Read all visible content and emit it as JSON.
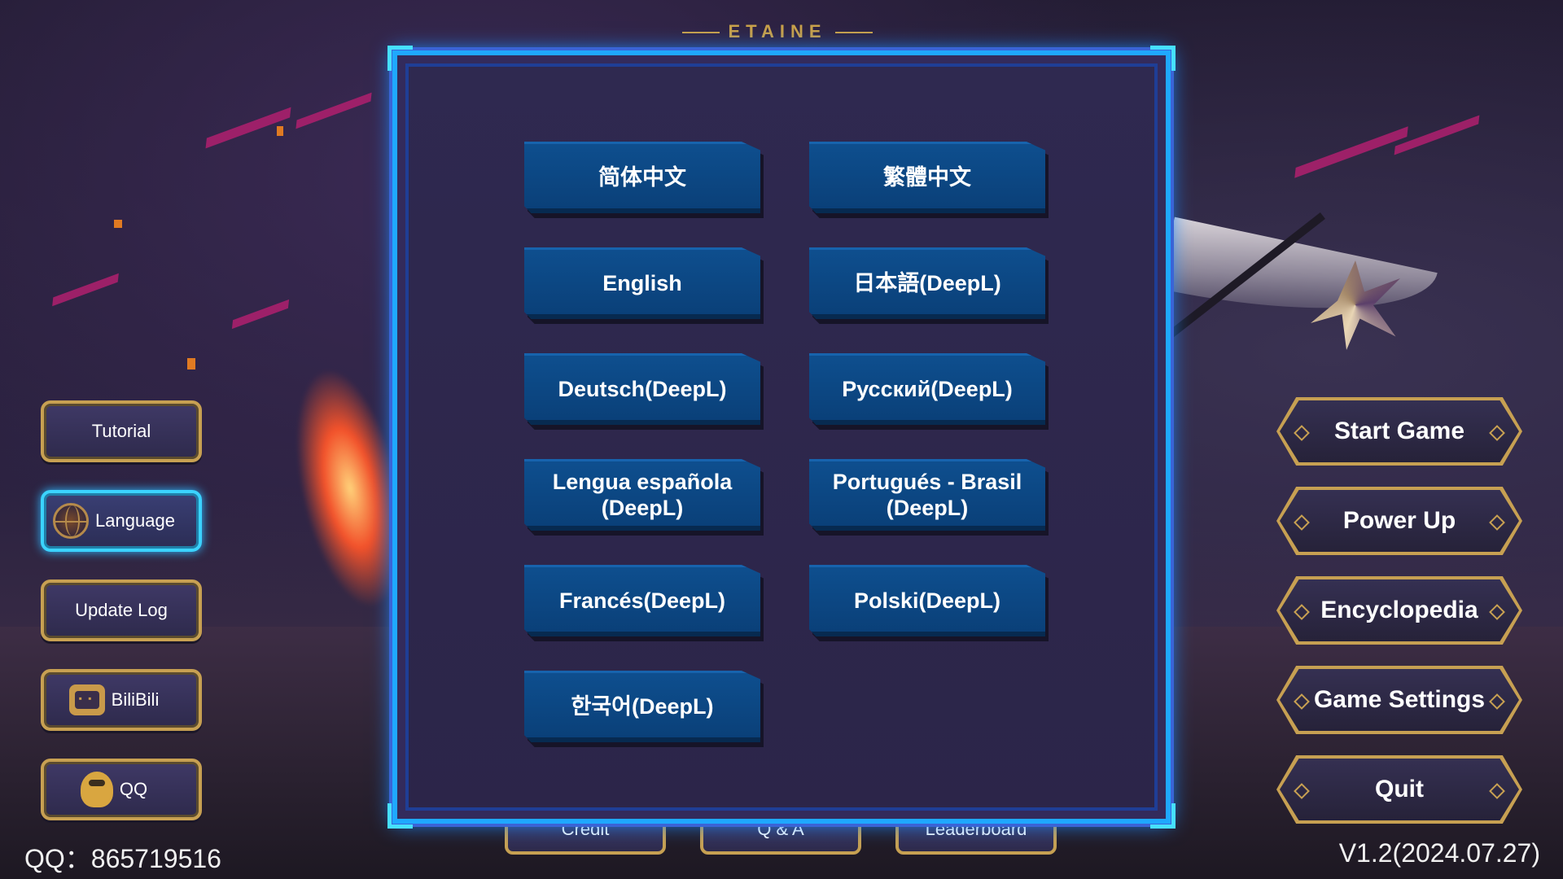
{
  "header": {
    "title": "ETAINE"
  },
  "left_menu": {
    "tutorial": "Tutorial",
    "language": "Language",
    "update_log": "Update Log",
    "bilibili": "BiliBili",
    "qq": "QQ"
  },
  "right_menu": {
    "start_game": "Start Game",
    "power_up": "Power Up",
    "encyclopedia": "Encyclopedia",
    "game_settings": "Game Settings",
    "quit": "Quit"
  },
  "bottom_tabs": {
    "credit": "Credit",
    "qa": "Q & A",
    "leaderboard": "Leaderboard"
  },
  "language_dialog": {
    "options": [
      "简体中文",
      "繁體中文",
      "English",
      "日本語(DeepL)",
      "Deutsch(DeepL)",
      "Русский(DeepL)",
      "Lengua española (DeepL)",
      "Portugués - Brasil (DeepL)",
      "Francés(DeepL)",
      "Polski(DeepL)",
      "한국어(DeepL)"
    ]
  },
  "footer": {
    "qq_number": "QQ：865719516",
    "version": "V1.2(2024.07.27)"
  },
  "icons": {
    "language": "globe-icon",
    "bilibili": "tv-icon",
    "qq": "penguin-icon"
  },
  "colors": {
    "gold_frame": "#c7a052",
    "cyan_frame": "#1fa8ff",
    "lang_button": "#0e4f8f"
  }
}
